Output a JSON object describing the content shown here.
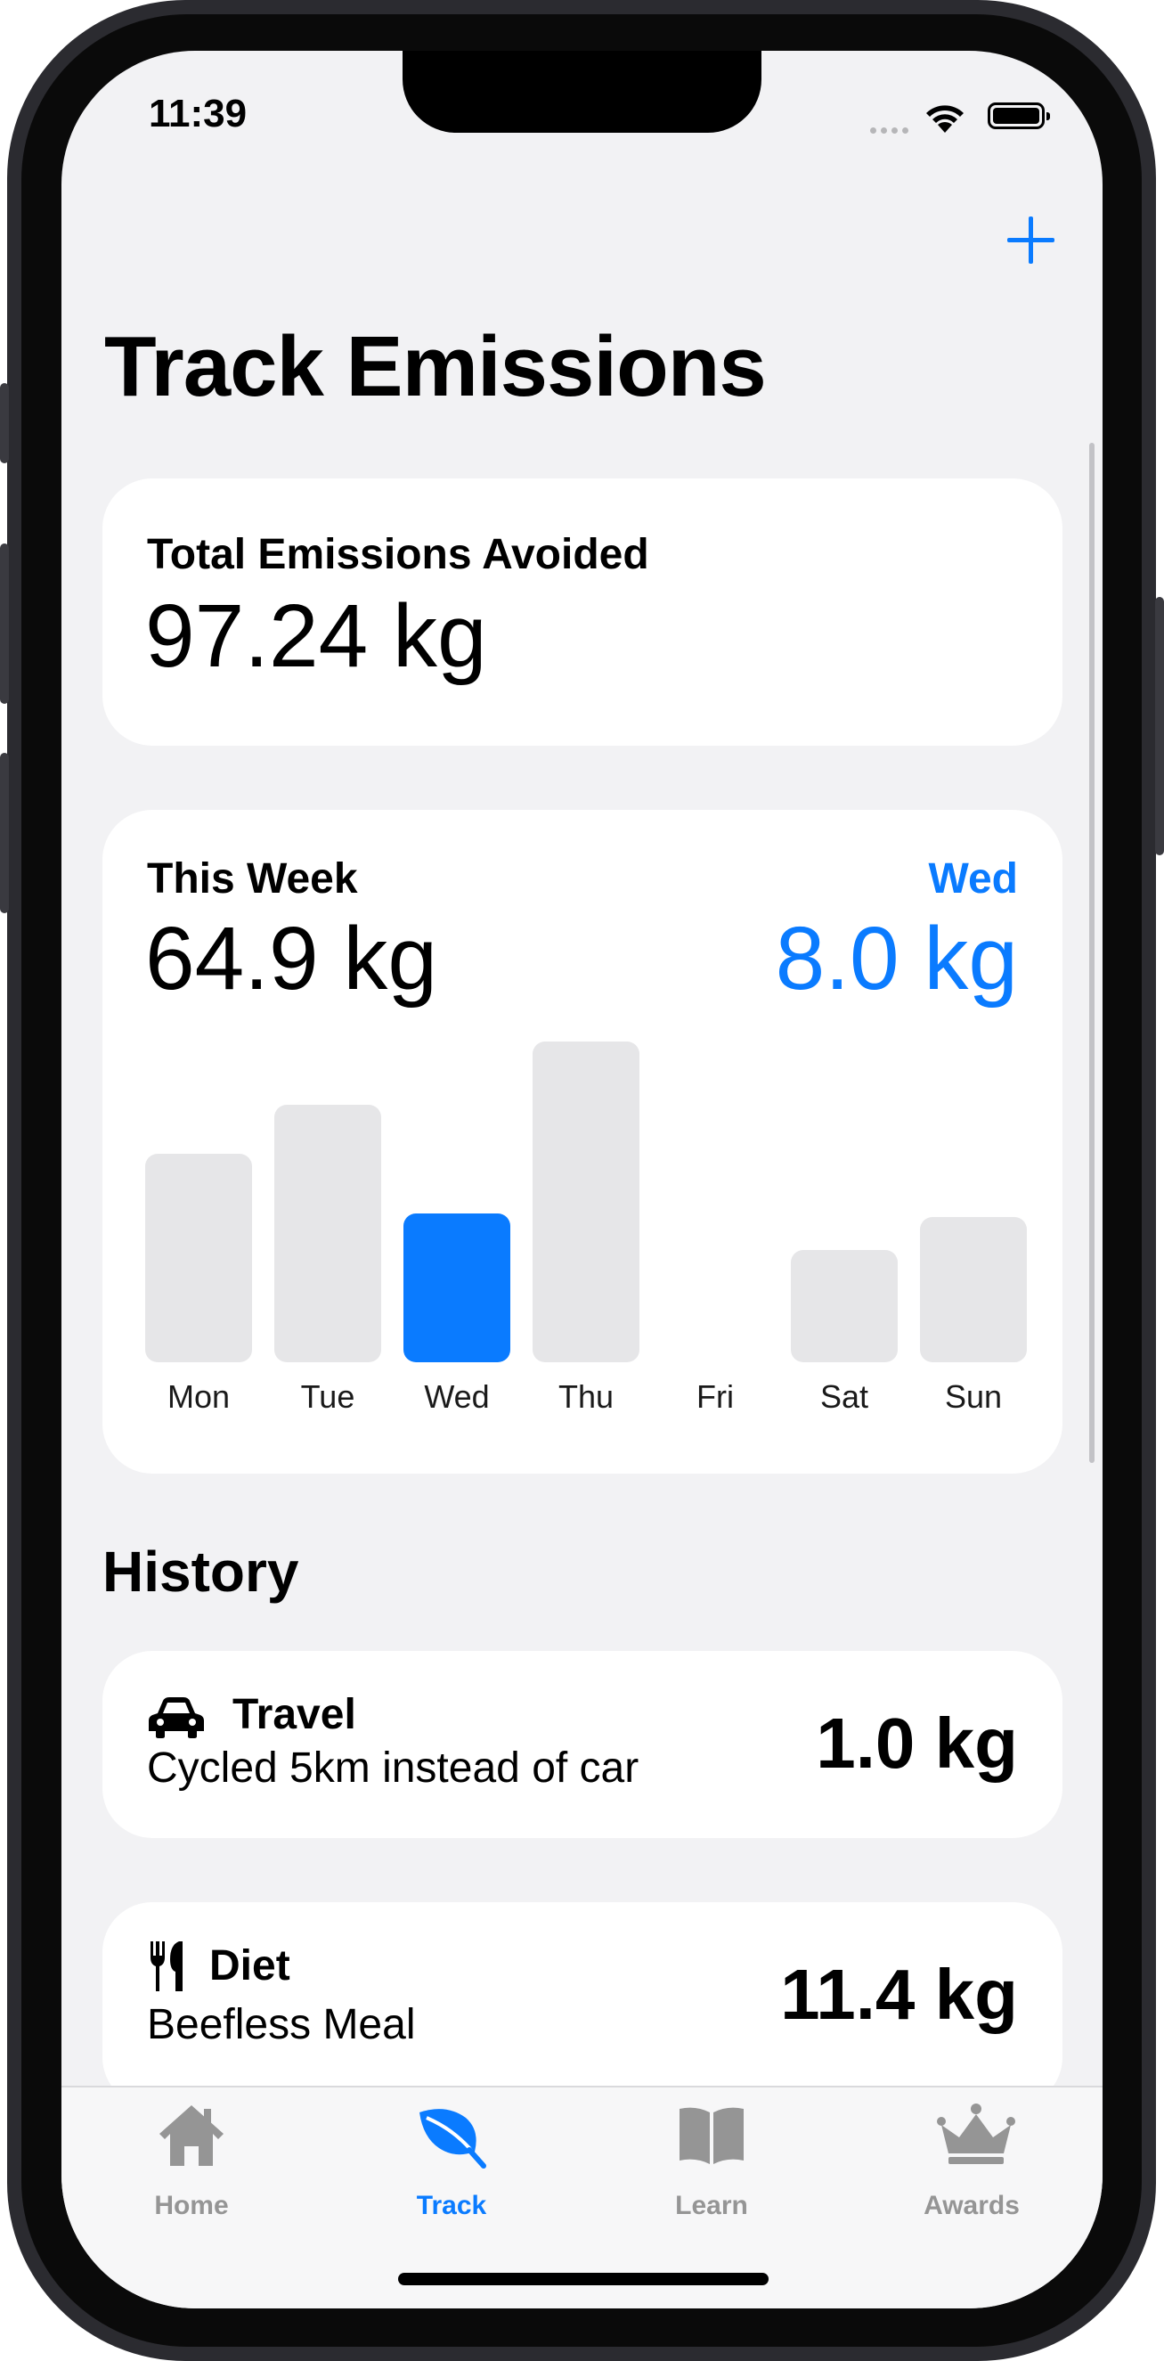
{
  "status": {
    "time": "11:39"
  },
  "page": {
    "title": "Track Emissions"
  },
  "total": {
    "label": "Total Emissions Avoided",
    "value": "97.24 kg"
  },
  "week": {
    "label": "This Week",
    "value": "64.9 kg",
    "selected_day": "Wed",
    "selected_value": "8.0 kg"
  },
  "chart_data": {
    "type": "bar",
    "categories": [
      "Mon",
      "Tue",
      "Wed",
      "Thu",
      "Fri",
      "Sat",
      "Sun"
    ],
    "values": [
      11.2,
      13.8,
      8.0,
      17.2,
      0,
      6.0,
      7.8
    ],
    "selected": "Wed",
    "colors": {
      "bar": "#e6e6e8",
      "selected": "#0a7bff"
    }
  },
  "history": {
    "title": "History",
    "items": [
      {
        "icon": "car-icon",
        "category": "Travel",
        "description": "Cycled 5km instead of car",
        "value": "1.0 kg"
      },
      {
        "icon": "fork-knife-icon",
        "category": "Diet",
        "description": "Beefless Meal",
        "value": "11.4 kg"
      }
    ]
  },
  "tabs": [
    {
      "label": "Home",
      "icon": "house-icon",
      "active": false
    },
    {
      "label": "Track",
      "icon": "leaf-icon",
      "active": true
    },
    {
      "label": "Learn",
      "icon": "book-icon",
      "active": false
    },
    {
      "label": "Awards",
      "icon": "crown-icon",
      "active": false
    }
  ],
  "colors": {
    "accent": "#0a7bff",
    "background": "#f2f2f4",
    "card": "#ffffff"
  }
}
